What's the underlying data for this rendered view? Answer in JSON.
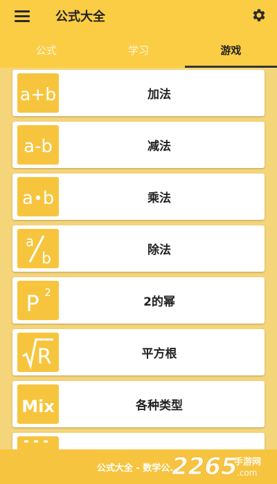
{
  "appbar": {
    "title": "公式大全"
  },
  "tabs": [
    {
      "label": "公式",
      "active": false
    },
    {
      "label": "学习",
      "active": false
    },
    {
      "label": "游戏",
      "active": true
    }
  ],
  "items": [
    {
      "label": "加法",
      "icon": "addition-icon"
    },
    {
      "label": "减法",
      "icon": "subtraction-icon"
    },
    {
      "label": "乘法",
      "icon": "multiplication-icon"
    },
    {
      "label": "除法",
      "icon": "division-icon"
    },
    {
      "label": "2的幂",
      "icon": "power-icon"
    },
    {
      "label": "平方根",
      "icon": "square-root-icon"
    },
    {
      "label": "各种类型",
      "icon": "mix-icon"
    },
    {
      "label": "",
      "icon": "partial-item-icon"
    }
  ],
  "icon_text": {
    "addition": "a+b",
    "subtraction": "a-b",
    "multiplication_a": "a",
    "multiplication_b": "b",
    "division_a": "a",
    "division_b": "b",
    "power_base": "P",
    "power_exp": "2",
    "root": "R",
    "mix": "Mix"
  },
  "footer": {
    "text": "公式大全 - 数学公..."
  },
  "watermark": {
    "number": "2265",
    "suffix": "手游网",
    "url": ".com"
  },
  "colors": {
    "accent": "#fbcd45",
    "icon_bg": "#f7c53d",
    "background": "#f5d57a"
  }
}
